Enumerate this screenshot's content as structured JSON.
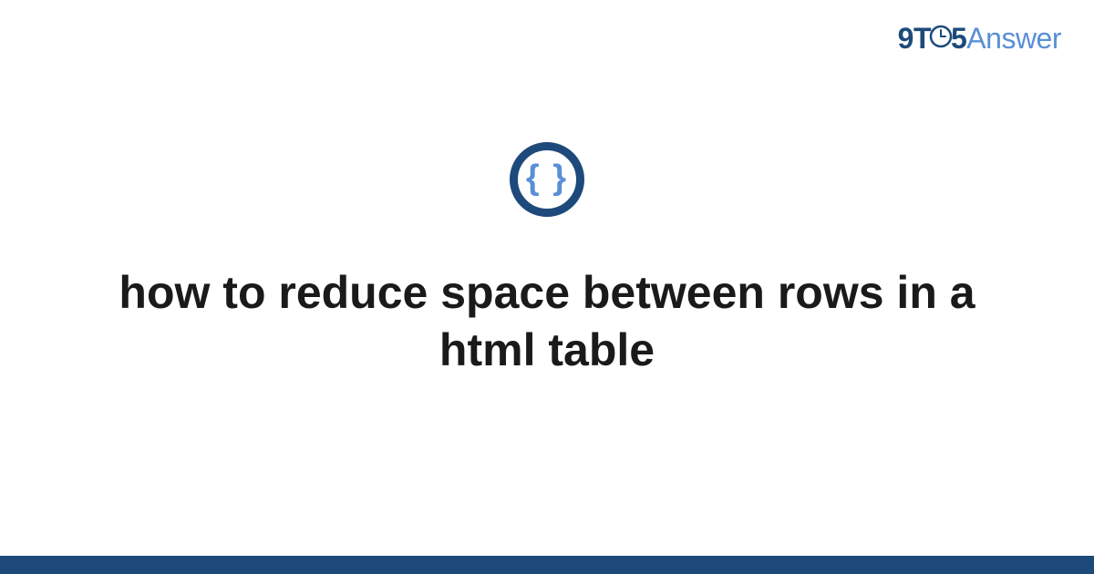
{
  "logo": {
    "part1": "9",
    "part2": "T",
    "part3": "5",
    "part4": "Answer"
  },
  "icon": {
    "braces": "{ }"
  },
  "title": "how to reduce space between rows in a html table"
}
